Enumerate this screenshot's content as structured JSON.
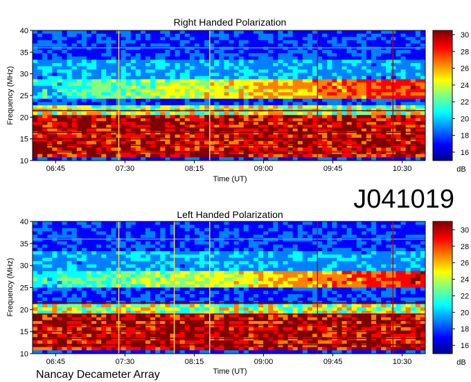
{
  "chart_data": [
    {
      "type": "heatmap",
      "title": "Right Handed Polarization",
      "xlabel": "Time (UT)",
      "ylabel": "Frequency (MHz)",
      "x_ticks": [
        "06:45",
        "07:30",
        "08:15",
        "09:00",
        "09:45",
        "10:30"
      ],
      "y_ticks": [
        10,
        15,
        20,
        25,
        30,
        35,
        40
      ],
      "ylim": [
        10,
        40
      ],
      "xlim": [
        "06:30",
        "10:45"
      ],
      "colorbar": {
        "label": "dB",
        "ticks": [
          16,
          18,
          20,
          22,
          24,
          26,
          28,
          30
        ],
        "range": [
          15,
          30.5
        ]
      },
      "features": {
        "strong_band_mhz": [
          10.5,
          20.5
        ],
        "emission_band_mhz": [
          24,
          29
        ],
        "interference_lines_mhz": [
          12,
          13.5,
          15,
          16.5,
          17.5,
          19,
          21.5,
          36
        ],
        "vertical_artifacts_ut": [
          "07:26",
          "08:25",
          "09:35",
          "10:24"
        ]
      }
    },
    {
      "type": "heatmap",
      "title": "Left Handed Polarization",
      "xlabel": "Time (UT)",
      "ylabel": "Frequency (MHz)",
      "x_ticks": [
        "06:45",
        "07:30",
        "08:15",
        "09:00",
        "09:45",
        "10:30"
      ],
      "y_ticks": [
        10,
        15,
        20,
        25,
        30,
        35,
        40
      ],
      "ylim": [
        10,
        40
      ],
      "xlim": [
        "06:30",
        "10:45"
      ],
      "colorbar": {
        "label": "dB",
        "ticks": [
          16,
          18,
          20,
          22,
          24,
          26,
          28,
          30
        ],
        "range": [
          15,
          31
        ]
      },
      "features": {
        "strong_band_mhz": [
          10.5,
          19
        ],
        "emission_band_mhz": [
          25,
          29
        ],
        "interference_lines_mhz": [
          12,
          13.5,
          15,
          16.5,
          17.5,
          19,
          21.5,
          36
        ],
        "vertical_artifacts_ut": [
          "07:26",
          "08:02",
          "08:25",
          "09:35",
          "10:24"
        ]
      }
    }
  ],
  "observation_id": "J041019",
  "footer": "Nancay Decameter Array",
  "colormap": [
    "#00008f",
    "#0000ff",
    "#0080ff",
    "#00ffff",
    "#80ff80",
    "#ffff00",
    "#ff8000",
    "#ff0000",
    "#800000"
  ]
}
